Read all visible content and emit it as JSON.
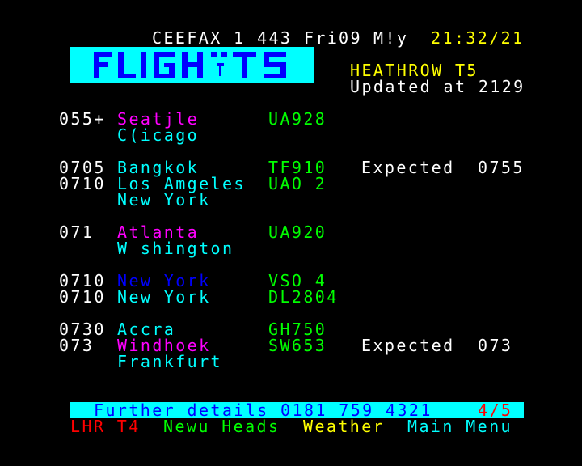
{
  "header": {
    "service": "CEEFAX",
    "magazine": "1",
    "page": "443",
    "day": "Fri",
    "date": "09",
    "month": "M!y",
    "time": "21:32/21"
  },
  "banner": {
    "logo_text": "FLIGHTS",
    "airport": "HEATHROW T5",
    "updated": "Updated at 2129"
  },
  "flights": [
    {
      "time": "055+",
      "destination": "Seatjle",
      "via": "C(icago",
      "flight": "UA928",
      "status": "",
      "status_time": ""
    },
    {
      "time": "0705",
      "destination": "Bangkok",
      "via": "",
      "flight": "TF910",
      "status": "Expected",
      "status_time": "0755"
    },
    {
      "time": "0710",
      "destination": "Los Amgeles",
      "via": "New York",
      "flight": "UAO 2",
      "status": "",
      "status_time": ""
    },
    {
      "time": "071",
      "destination": "Atlanta",
      "via": "W shington",
      "flight": "UA920",
      "status": "",
      "status_time": ""
    },
    {
      "time": "0710",
      "destination": "New York",
      "via": "",
      "flight": "VSO 4",
      "status": "",
      "status_time": ""
    },
    {
      "time": "0710",
      "destination": "New York",
      "via": "",
      "flight": "DL2804",
      "status": "",
      "status_time": ""
    },
    {
      "time": "0730",
      "destination": "Accra",
      "via": "",
      "flight": "GH750",
      "status": "",
      "status_time": ""
    },
    {
      "time": "073",
      "destination": "Windhoek",
      "via": "Frankfurt",
      "flight": "SW653",
      "status": "Expected",
      "status_time": "073"
    }
  ],
  "footer": {
    "details": "Further details 0181 759 4321",
    "page_count": "4/5"
  },
  "fastext": [
    {
      "label": "LHR T4",
      "color": "#ff0000"
    },
    {
      "label": "Newu Heads",
      "color": "#00ff00"
    },
    {
      "label": "Weather",
      "color": "#ffff00"
    },
    {
      "label": "Main Menu",
      "color": "#00ffff"
    }
  ],
  "colors": {
    "background": "#000000",
    "logo_bg": "#00ffff",
    "logo_fg": "#0000ff",
    "footer_bg": "#00ffff",
    "footer_fg": "#0000ff"
  }
}
